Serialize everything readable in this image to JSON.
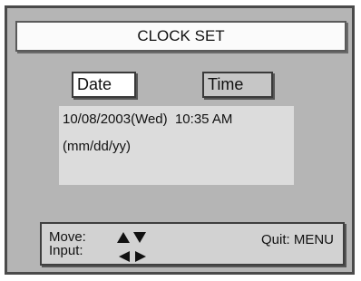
{
  "title": "CLOCK SET",
  "tabs": {
    "date_label": "Date",
    "time_label": "Time"
  },
  "panel": {
    "date_time": "10/08/2003(Wed)  10:35 AM",
    "format_hint": "(mm/dd/yy)"
  },
  "help": {
    "move_label": "Move:",
    "input_label": "Input:",
    "quit_label": "Quit: MENU"
  },
  "icons": {
    "move": "up-down-arrows-icon",
    "input": "left-right-arrows-icon"
  },
  "colors": {
    "background": "#b5b5b5",
    "panel": "#dcdcdc",
    "selected_tab": "#ffffff",
    "unselected_tab": "#c6c6c6",
    "text": "#111111"
  }
}
